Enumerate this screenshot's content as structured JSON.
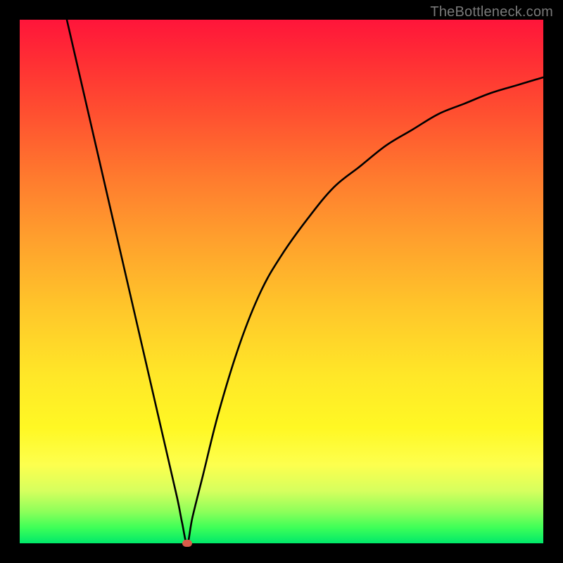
{
  "watermark": "TheBottleneck.com",
  "chart_data": {
    "type": "line",
    "title": "",
    "xlabel": "",
    "ylabel": "",
    "xlim": [
      0,
      100
    ],
    "ylim": [
      0,
      100
    ],
    "grid": false,
    "legend": false,
    "series": [
      {
        "name": "bottleneck-curve",
        "x": [
          9,
          12,
          15,
          18,
          21,
          24,
          27,
          30,
          31,
          32,
          33,
          35,
          38,
          42,
          46,
          50,
          55,
          60,
          65,
          70,
          75,
          80,
          85,
          90,
          95,
          100
        ],
        "y": [
          100,
          87,
          74,
          61,
          48,
          35,
          22,
          9,
          4,
          0,
          5,
          13,
          25,
          38,
          48,
          55,
          62,
          68,
          72,
          76,
          79,
          82,
          84,
          86,
          87.5,
          89
        ]
      }
    ],
    "marker": {
      "x": 32,
      "y": 0,
      "color": "#d95b4a"
    },
    "gradient_stops": [
      {
        "pos": 0,
        "color": "#ff153a"
      },
      {
        "pos": 50,
        "color": "#ffc62a"
      },
      {
        "pos": 85,
        "color": "#fdff4e"
      },
      {
        "pos": 100,
        "color": "#00e86a"
      }
    ]
  }
}
